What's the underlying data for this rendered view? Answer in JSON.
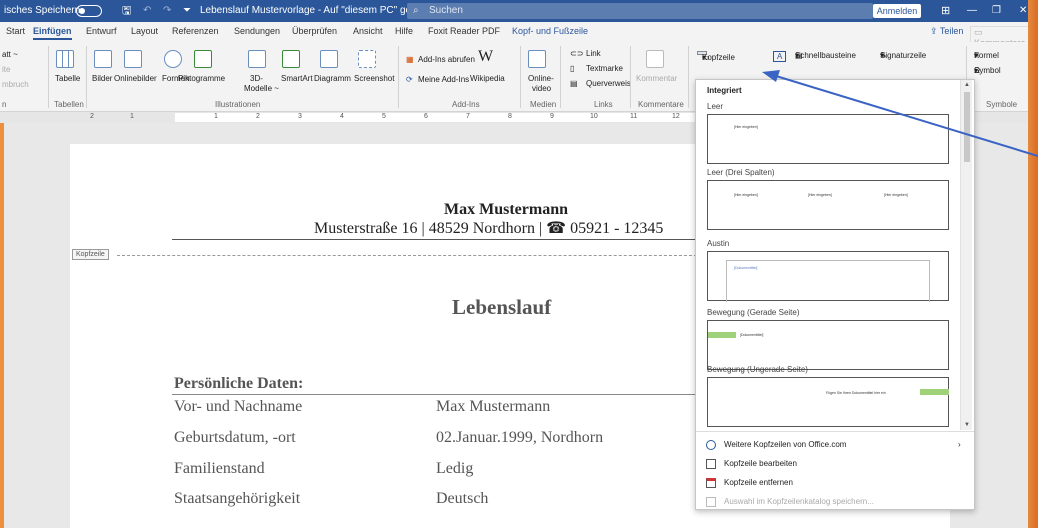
{
  "titlebar": {
    "autosave_label": "isches Speichern",
    "doc_title": "Lebenslauf Mustervorlage - Auf \"diesem PC\" gespeichert",
    "search_placeholder": "Suchen",
    "signin_label": "Anmelden"
  },
  "tabs": [
    "Start",
    "Einfügen",
    "Entwurf",
    "Layout",
    "Referenzen",
    "Sendungen",
    "Überprüfen",
    "Ansicht",
    "Hilfe",
    "Foxit Reader PDF",
    "Kopf- und Fußzeile"
  ],
  "tab_actions": {
    "share": "Teilen",
    "comments": "Kommentare"
  },
  "ribbon": {
    "left_partial": [
      "att ~",
      "ite",
      "mbruch",
      "n"
    ],
    "tabelle": "Tabelle",
    "bilder": "Bilder",
    "onlinebilder": "Onlinebilder",
    "formen": "Formen",
    "piktogramme": "Piktogramme",
    "modelle_1": "3D-",
    "modelle_2": "Modelle ~",
    "smartart": "SmartArt",
    "diagramm": "Diagramm",
    "screenshot": "Screenshot",
    "addins_abrufen": "Add-Ins abrufen",
    "meine_addins": "Meine Add-Ins",
    "wikipedia": "Wikipedia",
    "online_video_1": "Online-",
    "online_video_2": "video",
    "link": "Link",
    "textmarke": "Textmarke",
    "querverweis": "Querverweis",
    "kommentar": "Kommentar",
    "kopfzeile": "Kopfzeile",
    "schnellbausteine": "Schnellbausteine",
    "signaturzeile": "Signaturzeile",
    "formel": "Formel",
    "symbol": "Symbol",
    "groups": {
      "tabellen": "Tabellen",
      "illustrationen": "Illustrationen",
      "addins": "Add-Ins",
      "medien": "Medien",
      "links": "Links",
      "kommentare": "Kommentare",
      "symbole": "Symbole"
    }
  },
  "ruler_marks": [
    "2",
    "1",
    "1",
    "2",
    "3",
    "4",
    "5",
    "6",
    "7",
    "8",
    "9",
    "10",
    "11",
    "12"
  ],
  "document": {
    "header_tag": "Kopfzeile",
    "name": "Max Mustermann",
    "address": "Musterstraße 16 | 48529 Nordhorn | ☎ 05921 - 12345",
    "title": "Lebenslauf",
    "section": "Persönliche Daten:",
    "rows": [
      {
        "label": "Vor- und Nachname",
        "value": "Max Mustermann"
      },
      {
        "label": "Geburtsdatum, -ort",
        "value": "02.Januar.1999, Nordhorn"
      },
      {
        "label": "Familienstand",
        "value": "Ledig"
      },
      {
        "label": "Staatsangehörigkeit",
        "value": "Deutsch"
      }
    ]
  },
  "dropdown": {
    "category": "Integriert",
    "items": [
      {
        "name": "Leer",
        "placeholders": [
          "[Hier eingeben]"
        ]
      },
      {
        "name": "Leer (Drei Spalten)",
        "placeholders": [
          "[Hier eingeben]",
          "[Hier eingeben]",
          "[Hier eingeben]"
        ]
      },
      {
        "name": "Austin",
        "placeholders": [
          "[Dokumenttitel]"
        ]
      },
      {
        "name": "Bewegung (Gerade Seite)",
        "placeholders": [
          "[Dokumenttitel]"
        ]
      },
      {
        "name": "Bewegung (Ungerade Seite)",
        "placeholders": [
          "Fügen Sie Ihren Dokumenttitel hier ein"
        ]
      }
    ],
    "menu": [
      {
        "label": "Weitere Kopfzeilen von Office.com",
        "icon": "globe-icon"
      },
      {
        "label": "Kopfzeile bearbeiten",
        "icon": "edit-header-icon"
      },
      {
        "label": "Kopfzeile entfernen",
        "icon": "remove-header-icon"
      },
      {
        "label": "Auswahl im Kopfzeilenkatalog speichern...",
        "icon": "save-selection-icon",
        "disabled": true
      }
    ]
  },
  "colors": {
    "accent": "#2b579a",
    "frame": "#e98a3c",
    "arrow": "#3a64c4",
    "bewegung_green": "#9fd17a"
  }
}
